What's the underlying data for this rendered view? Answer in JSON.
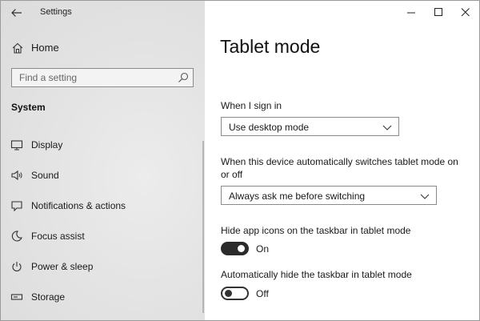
{
  "app": {
    "title": "Settings"
  },
  "sidebar": {
    "home_label": "Home",
    "search_placeholder": "Find a setting",
    "section_label": "System",
    "items": [
      {
        "label": "Display",
        "icon": "display-icon"
      },
      {
        "label": "Sound",
        "icon": "speaker-icon"
      },
      {
        "label": "Notifications & actions",
        "icon": "notification-icon"
      },
      {
        "label": "Focus assist",
        "icon": "moon-icon"
      },
      {
        "label": "Power & sleep",
        "icon": "power-icon"
      },
      {
        "label": "Storage",
        "icon": "storage-icon"
      }
    ]
  },
  "main": {
    "page_title": "Tablet mode",
    "sign_in": {
      "label": "When I sign in",
      "selected": "Use desktop mode"
    },
    "auto_switch": {
      "label": "When this device automatically switches tablet mode on or off",
      "selected": "Always ask me before switching"
    },
    "hide_icons": {
      "label": "Hide app icons on the taskbar in tablet mode",
      "state": "On"
    },
    "hide_taskbar": {
      "label": "Automatically hide the taskbar in tablet mode",
      "state": "Off"
    }
  },
  "window_controls": [
    "minimize-icon",
    "maximize-icon",
    "close-icon"
  ],
  "colors": {
    "sidebar_bg": "#e4e4e4",
    "toggle_on": "#2b2b2b",
    "text": "#1a1a1a"
  }
}
